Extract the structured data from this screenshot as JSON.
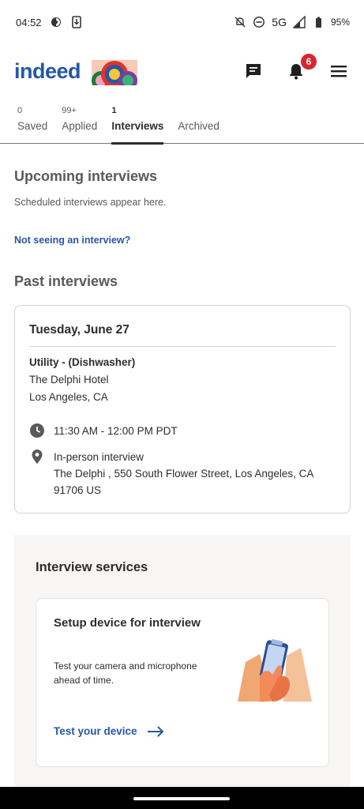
{
  "status_bar": {
    "time": "04:52",
    "network": "5G",
    "battery": "95%",
    "icons": [
      "settings-icon",
      "download-icon",
      "notifications-off-icon",
      "do-not-disturb-icon",
      "signal-icon",
      "battery-icon"
    ]
  },
  "header": {
    "logo_text": "indeed",
    "notification_count": "6",
    "icons": [
      "messages-icon",
      "bell-icon",
      "menu-icon"
    ]
  },
  "tabs": [
    {
      "count": "0",
      "label": "Saved",
      "active": false
    },
    {
      "count": "99+",
      "label": "Applied",
      "active": false
    },
    {
      "count": "1",
      "label": "Interviews",
      "active": true
    },
    {
      "count": "",
      "label": "Archived",
      "active": false
    }
  ],
  "upcoming": {
    "title": "Upcoming interviews",
    "empty_text": "Scheduled interviews appear here.",
    "help_link": "Not seeing an interview?"
  },
  "past": {
    "title": "Past interviews",
    "card": {
      "date": "Tuesday, June 27",
      "job_title": "Utility - (Dishwasher)",
      "company": "The Delphi Hotel",
      "job_location": "Los Angeles, CA",
      "time": "11:30 AM - 12:00 PM PDT",
      "interview_type": "In-person interview",
      "address": "The Delphi , 550 South Flower Street, Los Angeles, CA 91706 US"
    }
  },
  "services": {
    "title": "Interview services",
    "card": {
      "title": "Setup device for interview",
      "description": "Test your camera and microphone ahead of time.",
      "link": "Test your device"
    }
  },
  "colors": {
    "brand": "#2557a7",
    "badge": "#d9262f",
    "text": "#2d2d2d",
    "muted": "#595959"
  }
}
